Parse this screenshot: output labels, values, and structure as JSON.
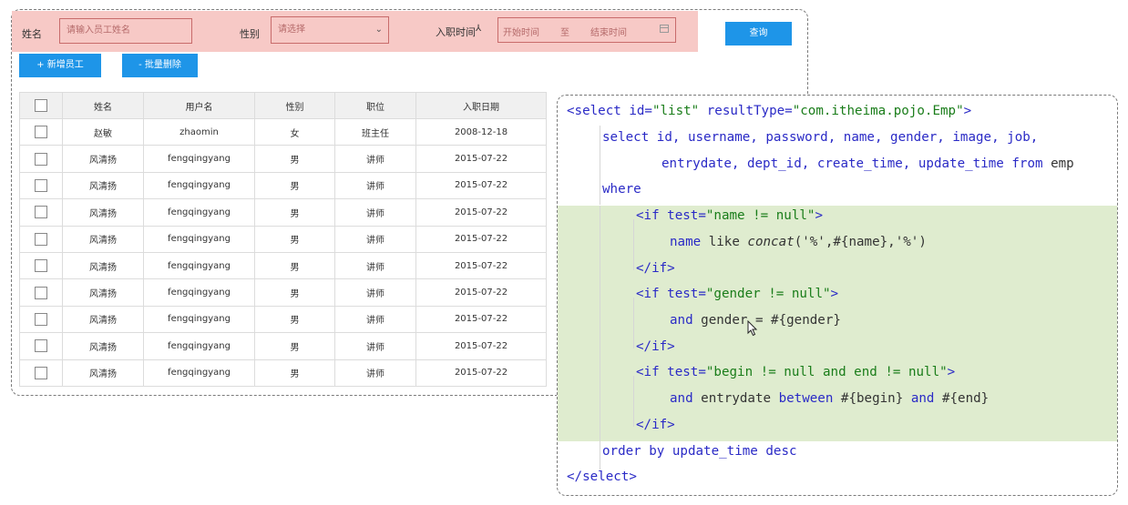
{
  "search": {
    "name_label": "姓名",
    "name_placeholder": "请输入员工姓名",
    "gender_label": "性别",
    "gender_placeholder": "请选择",
    "date_label": "入职时间",
    "date_start": "开始时间",
    "date_sep": "至",
    "date_end": "结束时间",
    "query_button": "查询"
  },
  "actions": {
    "add_button": "+ 新增员工",
    "delete_button": "- 批量删除"
  },
  "table": {
    "headers": [
      "姓名",
      "用户名",
      "性别",
      "职位",
      "入职日期"
    ],
    "rows": [
      [
        "赵敏",
        "zhaomin",
        "女",
        "班主任",
        "2008-12-18"
      ],
      [
        "风清扬",
        "fengqingyang",
        "男",
        "讲师",
        "2015-07-22"
      ],
      [
        "风清扬",
        "fengqingyang",
        "男",
        "讲师",
        "2015-07-22"
      ],
      [
        "风清扬",
        "fengqingyang",
        "男",
        "讲师",
        "2015-07-22"
      ],
      [
        "风清扬",
        "fengqingyang",
        "男",
        "讲师",
        "2015-07-22"
      ],
      [
        "风清扬",
        "fengqingyang",
        "男",
        "讲师",
        "2015-07-22"
      ],
      [
        "风清扬",
        "fengqingyang",
        "男",
        "讲师",
        "2015-07-22"
      ],
      [
        "风清扬",
        "fengqingyang",
        "男",
        "讲师",
        "2015-07-22"
      ],
      [
        "风清扬",
        "fengqingyang",
        "男",
        "讲师",
        "2015-07-22"
      ],
      [
        "风清扬",
        "fengqingyang",
        "男",
        "讲师",
        "2015-07-22"
      ]
    ]
  },
  "code": {
    "l1_a": "<select id=",
    "l1_b": "\"list\"",
    "l1_c": " resultType=",
    "l1_d": "\"com.itheima.pojo.Emp\"",
    "l1_e": ">",
    "l2_a": "select",
    "l2_b": " id, username, password, name, gender, image, job,",
    "l3": "entrydate, dept_id, create_time, update_time ",
    "l3_from": "from",
    "l3_emp": " emp",
    "l4": "where",
    "l5_a": "<if test=",
    "l5_b": "\"name != null\"",
    "l5_c": ">",
    "l6_a": "name ",
    "l6_b": "like",
    "l6_c": " concat",
    "l6_d": "('%',#{name},'%')",
    "l7": "</if>",
    "l8_a": "<if test=",
    "l8_b": "\"gender != null\"",
    "l8_c": ">",
    "l9_a": "and",
    "l9_b": " gender = #{gender}",
    "l10": "</if>",
    "l11_a": "<if test=",
    "l11_b": "\"begin != null and end != null\"",
    "l11_c": ">",
    "l12_a": "and",
    "l12_b": " entrydate ",
    "l12_c": "between",
    "l12_d": " #{begin} ",
    "l12_e": "and",
    "l12_f": " #{end}",
    "l13": "</if>",
    "l14_a": "order by",
    "l14_b": " update_time ",
    "l14_c": "desc",
    "l15": "</select>"
  },
  "colors": {
    "search_bg": "#f7c9c6",
    "button_blue": "#1e95e8",
    "highlight_green": "#dfeccf",
    "keyword_blue": "#2a2ac6",
    "string_green": "#1a7d1a"
  },
  "icons": [
    "chevron-down-icon",
    "calendar-icon",
    "checkbox-icon",
    "mouse-cursor-icon"
  ]
}
